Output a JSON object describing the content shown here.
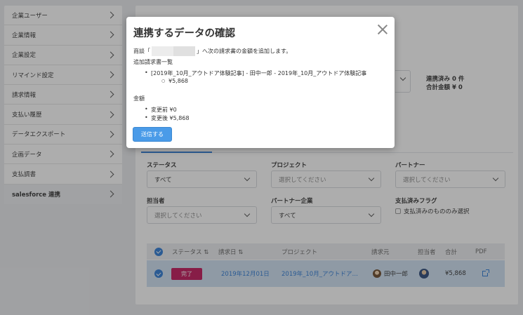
{
  "sidebar": {
    "items": [
      {
        "label": "企業ユーザー"
      },
      {
        "label": "企業情報"
      },
      {
        "label": "企業設定"
      },
      {
        "label": "リマインド設定"
      },
      {
        "label": "請求情報"
      },
      {
        "label": "支払い履歴"
      },
      {
        "label": "データエクスポート"
      },
      {
        "label": "企画データ"
      },
      {
        "label": "支払調書"
      },
      {
        "label": "salesforce 連携"
      }
    ]
  },
  "summary": {
    "linked_count": "連携済み 0 件",
    "total_amount": "合計金額 ¥ 0"
  },
  "filters": {
    "status_label": "ステータス",
    "status_value": "すべて",
    "project_label": "プロジェクト",
    "project_placeholder": "選択してください",
    "partner_label": "パートナー",
    "partner_placeholder": "選択してください",
    "owner_label": "担当者",
    "owner_placeholder": "選択してください",
    "partner_company_label": "パートナー企業",
    "partner_company_value": "すべて",
    "paid_flag_label": "支払済みフラグ",
    "paid_only_label": "支払済みのもののみ選択"
  },
  "table": {
    "headers": {
      "status": "ステータス ⇅",
      "invoice_date": "請求日 ⇅",
      "project": "プロジェクト",
      "billed_from": "請求元",
      "owner": "担当者",
      "total": "合計",
      "pdf": "PDF"
    },
    "rows": [
      {
        "status": "完了",
        "invoice_date": "2019年12月01日",
        "project": "2019年_10月_アウトドア…",
        "billed_from": "田中一郎",
        "total": "¥5,868"
      }
    ]
  },
  "modal": {
    "title": "連携するデータの確認",
    "deal_prefix": "商談「",
    "deal_suffix": "」へ次の請求書の金額を追加します。",
    "invoice_list_heading": "追加請求書一覧",
    "invoice_link": "[2019年_10月_アウトドア体験記事] - 田中一郎 - 2019年_10月_アウトドア体験記事",
    "invoice_amount": "¥5,868",
    "amount_heading": "金額",
    "before_label": "変更前 ¥0",
    "after_label": "変更後 ¥5,868",
    "send_button": "送信する"
  },
  "colors": {
    "accent": "#2e7bd6",
    "status_done": "#c2185b",
    "send_button": "#4a9be8"
  }
}
